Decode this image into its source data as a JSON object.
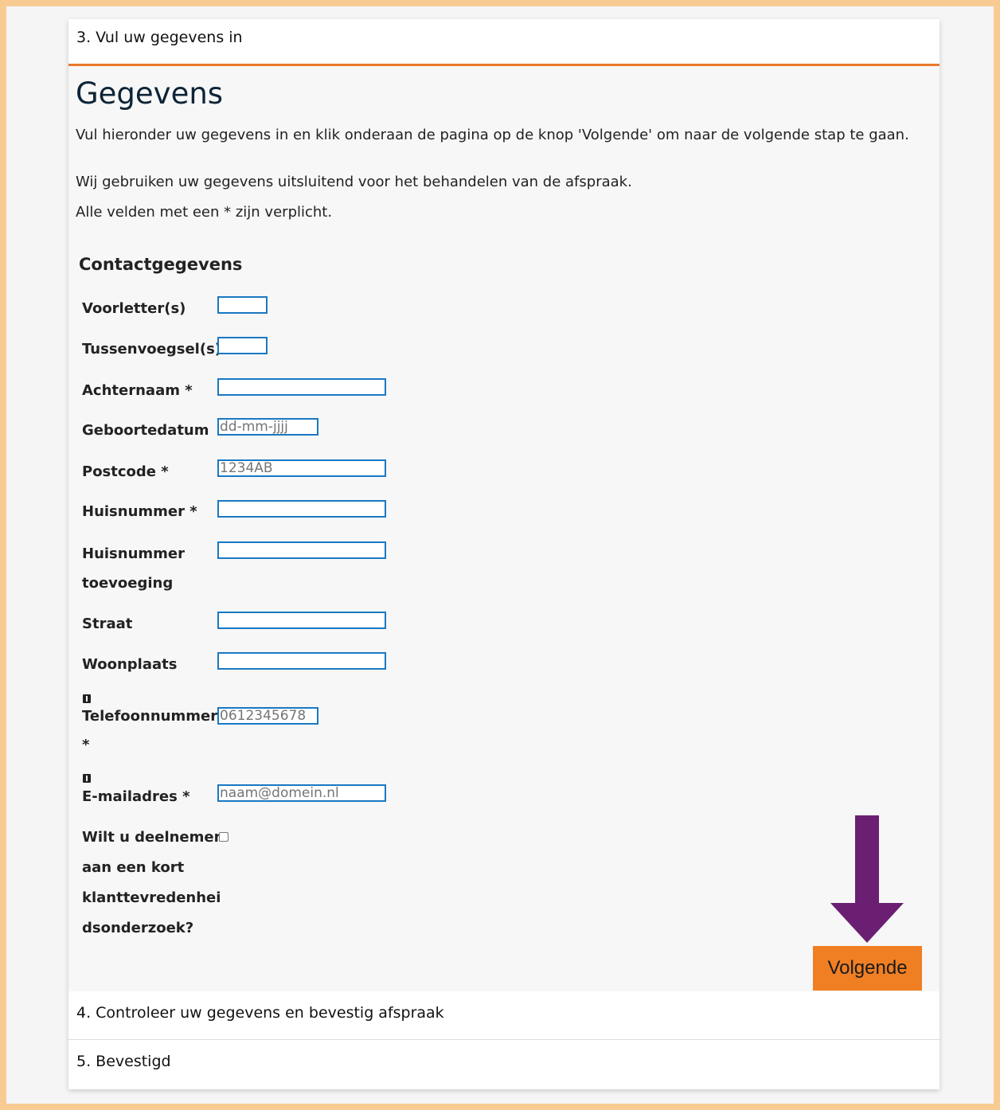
{
  "steps": {
    "step3": "3. Vul uw gegevens in",
    "step4": "4. Controleer uw gegevens en bevestig afspraak",
    "step5": "5. Bevestigd"
  },
  "page": {
    "title": "Gegevens",
    "intro": "Vul hieronder uw gegevens in en klik onderaan de pagina op de knop 'Volgende' om naar de volgende stap te gaan.",
    "privacy": "Wij gebruiken uw gegevens uitsluitend voor het behandelen van de afspraak.",
    "required_note": "Alle velden met een * zijn verplicht."
  },
  "form": {
    "section_title": "Contactgegevens",
    "fields": {
      "voorletters": {
        "label": "Voorletter(s)",
        "value": "",
        "placeholder": ""
      },
      "tussenvoegsels": {
        "label": "Tussenvoegsel(s)",
        "value": "",
        "placeholder": ""
      },
      "achternaam": {
        "label": "Achternaam *",
        "value": "",
        "placeholder": ""
      },
      "geboortedatum": {
        "label": "Geboortedatum",
        "value": "",
        "placeholder": "dd-mm-jjjj"
      },
      "postcode": {
        "label": "Postcode *",
        "value": "",
        "placeholder": "1234AB"
      },
      "huisnummer": {
        "label": "Huisnummer *",
        "value": "",
        "placeholder": ""
      },
      "huisnummer_toevoeging": {
        "label_line1": "Huisnummer",
        "label_line2": "toevoeging",
        "value": "",
        "placeholder": ""
      },
      "straat": {
        "label": "Straat",
        "value": "",
        "placeholder": ""
      },
      "woonplaats": {
        "label": "Woonplaats",
        "value": "",
        "placeholder": ""
      },
      "telefoonnummer": {
        "label_line1": "Telefoonnummer",
        "label_line2": "*",
        "value": "",
        "placeholder": "0612345678",
        "icon": "info-icon"
      },
      "email": {
        "label": "E-mailadres *",
        "value": "",
        "placeholder": "naam@domein.nl",
        "icon": "info-icon"
      },
      "survey": {
        "label_lines": [
          "Wilt u deelnemen",
          "aan een kort",
          "klanttevredenhei",
          "dsonderzoek?"
        ],
        "checked": false
      }
    },
    "next_button": "Volgende"
  },
  "annotation": {
    "arrow_color": "#6a1f72",
    "icon": "arrow-down-icon"
  },
  "colors": {
    "accent": "#e8792a",
    "button": "#f07f24",
    "input_border": "#1a78c2",
    "title": "#0d2437"
  }
}
